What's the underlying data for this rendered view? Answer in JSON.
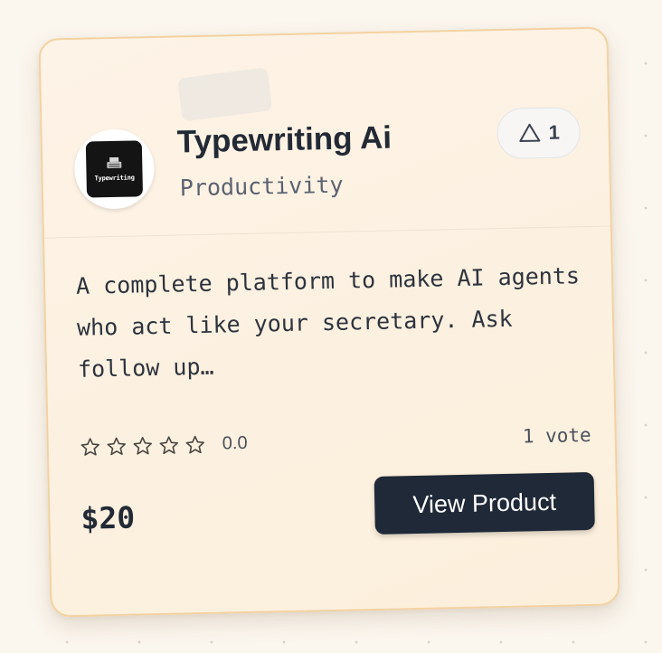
{
  "product": {
    "title": "Typewriting Ai",
    "category": "Productivity",
    "logo_text": "Typewriting",
    "description": "A complete platform to make AI agents who act like your secretary. Ask follow up…",
    "upvotes": "1",
    "rating_value": "0.0",
    "stars_filled": 0,
    "stars_total": 5,
    "votes_label": "1 vote",
    "price": "$20",
    "cta_label": "View Product"
  },
  "icons": {
    "upvote": "triangle-up-icon",
    "star": "star-outline-icon",
    "logo": "typewriter-icon"
  },
  "colors": {
    "card_border": "#f3d2a2",
    "card_background": "#fdf3e6",
    "button_background": "#1f2937",
    "title_text": "#222a35"
  }
}
